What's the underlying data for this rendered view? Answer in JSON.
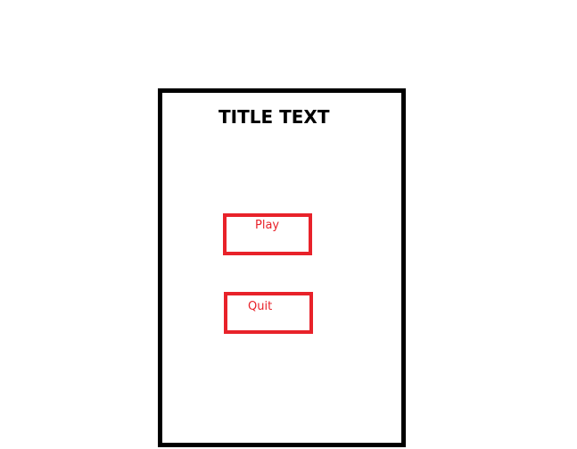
{
  "menu": {
    "title": "TITLE TEXT",
    "play_label": "Play",
    "quit_label": "Quit"
  },
  "colors": {
    "frame": "#000000",
    "button_accent": "#e8222a",
    "background": "#ffffff"
  }
}
